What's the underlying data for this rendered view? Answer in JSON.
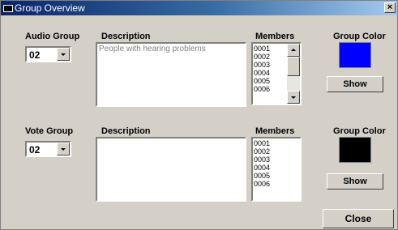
{
  "window": {
    "title": "Group Overview",
    "close_label": "×"
  },
  "audio": {
    "group_label": "Audio Group",
    "group_value": "02",
    "description_label": "Description",
    "description_text": "People with hearing problems",
    "members_label": "Members",
    "members": [
      "0001",
      "0002",
      "0003",
      "0004",
      "0005",
      "0006"
    ],
    "color_label": "Group Color",
    "color": "#0000ff",
    "show_label": "Show"
  },
  "vote": {
    "group_label": "Vote Group",
    "group_value": "02",
    "description_label": "Description",
    "description_text": "",
    "members_label": "Members",
    "members": [
      "0001",
      "0002",
      "0003",
      "0004",
      "0005",
      "0006"
    ],
    "color_label": "Group Color",
    "color": "#000000",
    "show_label": "Show"
  },
  "close_button_label": "Close"
}
